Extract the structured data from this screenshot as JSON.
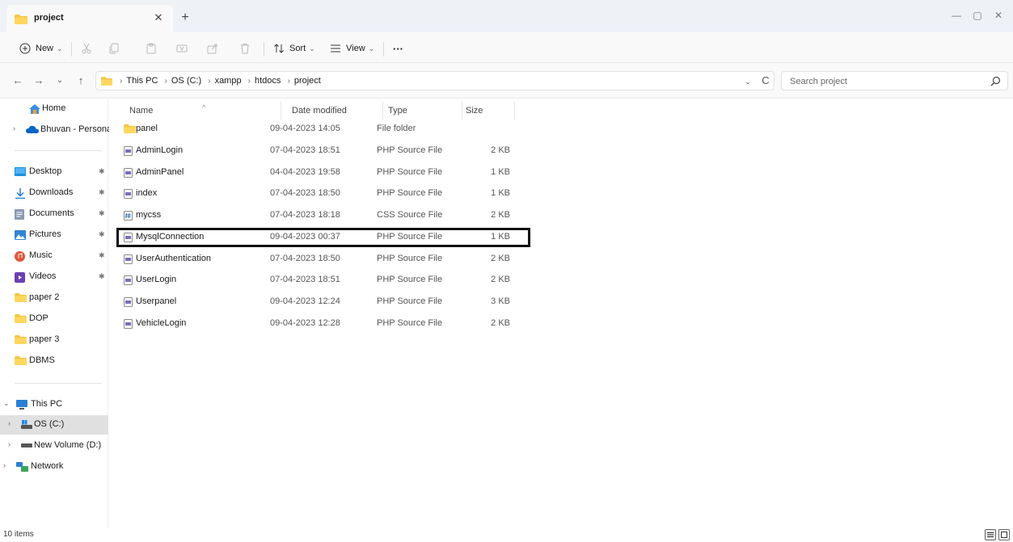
{
  "tab": {
    "title": "project",
    "close_glyph": "✕",
    "new_glyph": "+"
  },
  "window": {
    "minimize": "—",
    "maximize": "▢",
    "close": "✕"
  },
  "toolbar": {
    "new_label": "New",
    "sort_label": "Sort",
    "view_label": "View",
    "more_glyph": "···",
    "caret": "⌄"
  },
  "nav": {
    "back": "←",
    "forward": "→",
    "recent": "⌄",
    "up": "↑",
    "refresh": "C",
    "history": "⌄"
  },
  "breadcrumb": [
    "This PC",
    "OS (C:)",
    "xampp",
    "htdocs",
    "project"
  ],
  "search": {
    "placeholder": "Search project"
  },
  "sidebar": {
    "items": [
      {
        "label": "Home",
        "icon": "home-icon"
      },
      {
        "label": "Bhuvan - Personal",
        "icon": "cloud-icon",
        "expand": "›"
      },
      {
        "label": "Desktop",
        "icon": "desktop-icon",
        "pin": "📌"
      },
      {
        "label": "Downloads",
        "icon": "download-icon",
        "pin": "📌"
      },
      {
        "label": "Documents",
        "icon": "documents-icon",
        "pin": "📌"
      },
      {
        "label": "Pictures",
        "icon": "pictures-icon",
        "pin": "📌"
      },
      {
        "label": "Music",
        "icon": "music-icon",
        "pin": "📌"
      },
      {
        "label": "Videos",
        "icon": "videos-icon",
        "pin": "📌"
      },
      {
        "label": "paper 2",
        "icon": "folder-icon"
      },
      {
        "label": "DOP",
        "icon": "folder-icon"
      },
      {
        "label": "paper 3",
        "icon": "folder-icon"
      },
      {
        "label": "DBMS",
        "icon": "folder-icon"
      },
      {
        "label": "This PC",
        "icon": "computer-icon",
        "expand": "⌄"
      },
      {
        "label": "OS (C:)",
        "icon": "drive-icon",
        "expand": "›"
      },
      {
        "label": "New Volume (D:)",
        "icon": "drive-icon",
        "expand": "›"
      },
      {
        "label": "Network",
        "icon": "network-icon",
        "expand": "›"
      }
    ]
  },
  "columns": {
    "name": "Name",
    "date": "Date modified",
    "type": "Type",
    "size": "Size",
    "sort_glyph": "^"
  },
  "files": [
    {
      "name": "panel",
      "date": "09-04-2023 14:05",
      "type": "File folder",
      "size": ""
    },
    {
      "name": "AdminLogin",
      "date": "07-04-2023 18:51",
      "type": "PHP Source File",
      "size": "2 KB"
    },
    {
      "name": "AdminPanel",
      "date": "04-04-2023 19:58",
      "type": "PHP Source File",
      "size": "1 KB"
    },
    {
      "name": "index",
      "date": "07-04-2023 18:50",
      "type": "PHP Source File",
      "size": "1 KB"
    },
    {
      "name": "mycss",
      "date": "07-04-2023 18:18",
      "type": "CSS Source File",
      "size": "2 KB"
    },
    {
      "name": "MysqlConnection",
      "date": "09-04-2023 00:37",
      "type": "PHP Source File",
      "size": "1 KB"
    },
    {
      "name": "UserAuthentication",
      "date": "07-04-2023 18:50",
      "type": "PHP Source File",
      "size": "2 KB"
    },
    {
      "name": "UserLogin",
      "date": "07-04-2023 18:51",
      "type": "PHP Source File",
      "size": "2 KB"
    },
    {
      "name": "Userpanel",
      "date": "09-04-2023 12:24",
      "type": "PHP Source File",
      "size": "3 KB"
    },
    {
      "name": "VehicleLogin",
      "date": "09-04-2023 12:28",
      "type": "PHP Source File",
      "size": "2 KB"
    }
  ],
  "status": {
    "item_count": "10 items"
  },
  "colors": {
    "folder": "#f5c542",
    "highlight_border": "#111111",
    "selected_bg": "#e0e0e0",
    "accent": "#0067c0"
  }
}
